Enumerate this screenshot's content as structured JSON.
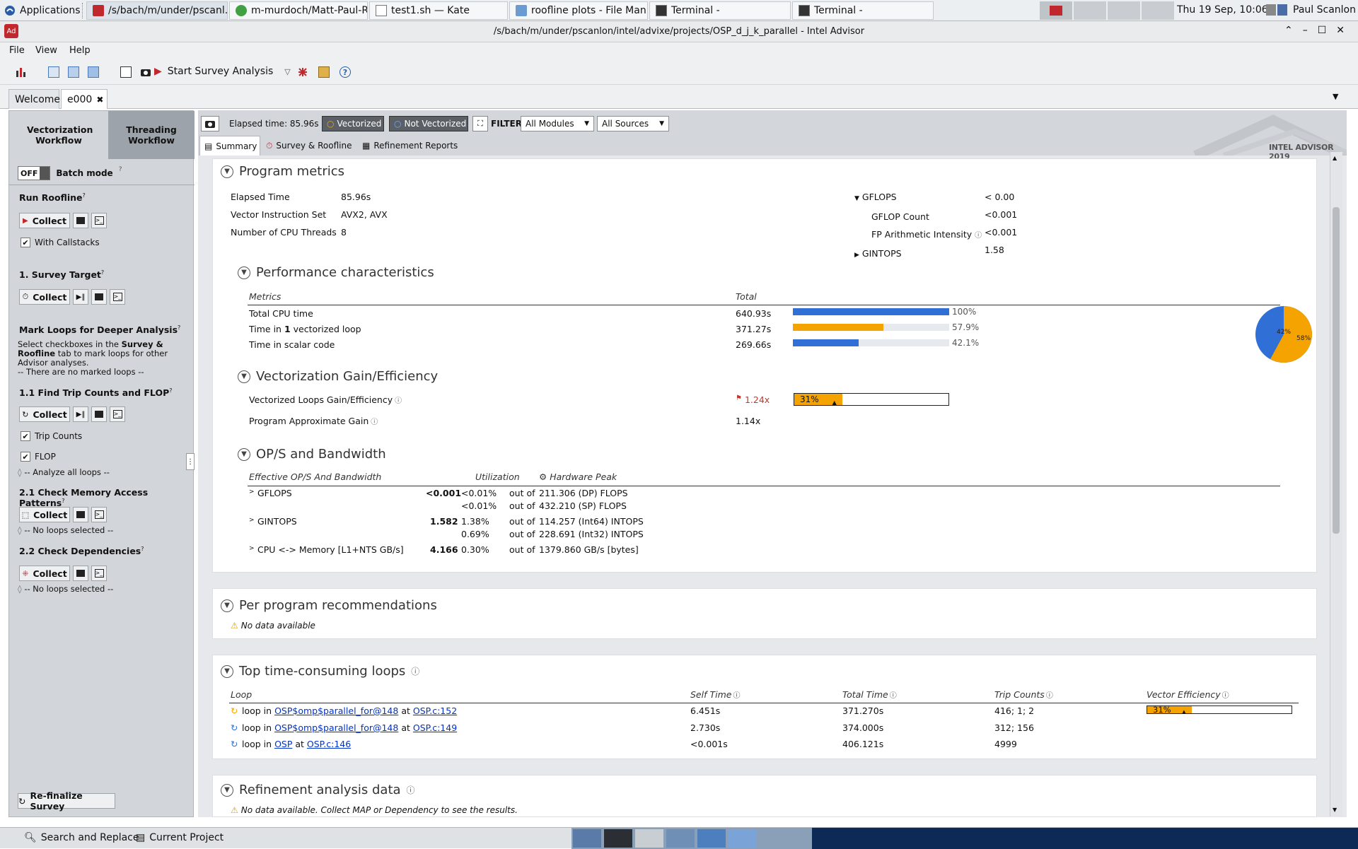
{
  "taskbar": {
    "applications_label": "Applications",
    "tasks": [
      {
        "label": "/s/bach/m/under/pscanl..."
      },
      {
        "label": "m-murdoch/Matt-Paul-R..."
      },
      {
        "label": "test1.sh  — Kate"
      },
      {
        "label": "roofline plots - File Man..."
      },
      {
        "label": "Terminal -"
      },
      {
        "label": "Terminal -"
      }
    ],
    "clock": "Thu 19 Sep, 10:06",
    "user": "Paul Scanlon"
  },
  "window": {
    "title": "/s/bach/m/under/pscanlon/intel/advixe/projects/OSP_d_j_k_parallel - Intel Advisor",
    "menu": [
      "File",
      "View",
      "Help"
    ],
    "toolbar_start": "Start Survey Analysis",
    "tabs": [
      "Welcome",
      "e000"
    ]
  },
  "left": {
    "workflow_tabs": [
      "Vectorization Workflow",
      "Threading Workflow"
    ],
    "batch_off": "OFF",
    "batch_label": "Batch mode",
    "run_roofline": "Run Roofline",
    "collect": "Collect",
    "with_callstacks": "With Callstacks",
    "survey_target": "1. Survey Target",
    "mark_loops": "Mark Loops for Deeper Analysis",
    "mark_desc_1": "Select checkboxes in the",
    "mark_desc_b1": "Survey &",
    "mark_desc_b2": "Roofline",
    "mark_desc_2": "tab to mark loops for other",
    "mark_desc_3": "Advisor analyses.",
    "no_marked": "-- There are no marked loops --",
    "find_trip": "1.1 Find Trip Counts and FLOP",
    "trip_counts": "Trip Counts",
    "flop": "FLOP",
    "analyze_all": "-- Analyze all loops --",
    "check_mem": "2.1 Check Memory Access Patterns",
    "no_loops_1": "-- No loops selected --",
    "check_dep": "2.2 Check Dependencies",
    "no_loops_2": "-- No loops selected --",
    "refinalize": "Re-finalize Survey"
  },
  "strip": {
    "elapsed": "Elapsed time: 85.96s",
    "vectorized": "Vectorized",
    "not_vectorized": "Not Vectorized",
    "filter": "FILTER:",
    "modules": "All Modules",
    "sources": "All Sources",
    "subtabs": [
      "Summary",
      "Survey & Roofline",
      "Refinement Reports"
    ],
    "brand": "INTEL ADVISOR 2019"
  },
  "program_metrics": {
    "title": "Program metrics",
    "rows": [
      {
        "label": "Elapsed Time",
        "value": "85.96s"
      },
      {
        "label": "Vector Instruction Set",
        "value": "AVX2, AVX"
      },
      {
        "label": "Number of CPU Threads",
        "value": "8"
      }
    ],
    "gflops_label": "GFLOPS",
    "gflops_value": "< 0.00",
    "gflop_count_label": "GFLOP Count",
    "gflop_count_value": "<0.001",
    "fp_ai_label": "FP Arithmetic Intensity",
    "fp_ai_value": "<0.001",
    "gintops_label": "GINTOPS",
    "gintops_value": "1.58"
  },
  "perf": {
    "title": "Performance characteristics",
    "col_metrics": "Metrics",
    "col_total": "Total",
    "rows": [
      {
        "label": "Total CPU time",
        "total": "640.93s",
        "pct_text": "100%",
        "pct": 100,
        "color": "#2f6fd6"
      },
      {
        "label_pre": "Time in ",
        "label_bold": "1",
        "label_post": " vectorized loop",
        "total": "371.27s",
        "pct_text": "57.9%",
        "pct": 57.9,
        "color": "#f5a300"
      },
      {
        "label": "Time in scalar code",
        "total": "269.66s",
        "pct_text": "42.1%",
        "pct": 42.1,
        "color": "#2f6fd6"
      }
    ],
    "pie": {
      "blue_label": "42%",
      "orange_label": "58%",
      "orange_fraction": 0.579
    }
  },
  "vec": {
    "title": "Vectorization Gain/Efficiency",
    "gain_label": "Vectorized Loops Gain/Efficiency",
    "gain_value": "1.24x",
    "eff_text": "31%",
    "eff": 31,
    "approx_label": "Program Approximate Gain",
    "approx_value": "1.14x"
  },
  "ops": {
    "title": "OP/S and Bandwidth",
    "col_eff": "Effective OP/S And Bandwidth",
    "col_util": "Utilization",
    "col_peak": "Hardware Peak",
    "out_of": "out of",
    "rows": [
      {
        "name": "GFLOPS",
        "value": "<0.001",
        "util": "<0.01%",
        "peak": "211.306 (DP) FLOPS",
        "util2": "<0.01%",
        "peak2": "432.210 (SP) FLOPS"
      },
      {
        "name": "GINTOPS",
        "value": "1.582",
        "util": "1.38%",
        "peak": "114.257 (Int64) INTOPS",
        "util2": "0.69%",
        "peak2": "228.691 (Int32) INTOPS"
      },
      {
        "name": "CPU <-> Memory [L1+NTS GB/s]",
        "value": "4.166",
        "util": "0.30%",
        "peak": "1379.860 GB/s [bytes]"
      }
    ]
  },
  "recs": {
    "title": "Per program recommendations",
    "no_data": "No data available"
  },
  "loops": {
    "title": "Top time-consuming loops",
    "cols": [
      "Loop",
      "Self Time",
      "Total Time",
      "Trip Counts",
      "Vector Efficiency"
    ],
    "loop_in": "loop in",
    "at": "at",
    "rows": [
      {
        "func": "OSP$omp$parallel_for@148",
        "src": "OSP.c:152",
        "self": "6.451s",
        "total": "371.270s",
        "trips": "416; 1; 2",
        "eff_text": "31%",
        "eff": 31
      },
      {
        "func": "OSP$omp$parallel_for@148",
        "src": "OSP.c:149",
        "self": "2.730s",
        "total": "374.000s",
        "trips": "312; 156"
      },
      {
        "func": "OSP",
        "src": "OSP.c:146",
        "self": "<0.001s",
        "total": "406.121s",
        "trips": "4999"
      }
    ]
  },
  "refine": {
    "title": "Refinement analysis data",
    "no_data": "No data available. Collect MAP or Dependency to see the results."
  },
  "bottom": {
    "search": "Search and Replace",
    "project": "Current Project"
  }
}
